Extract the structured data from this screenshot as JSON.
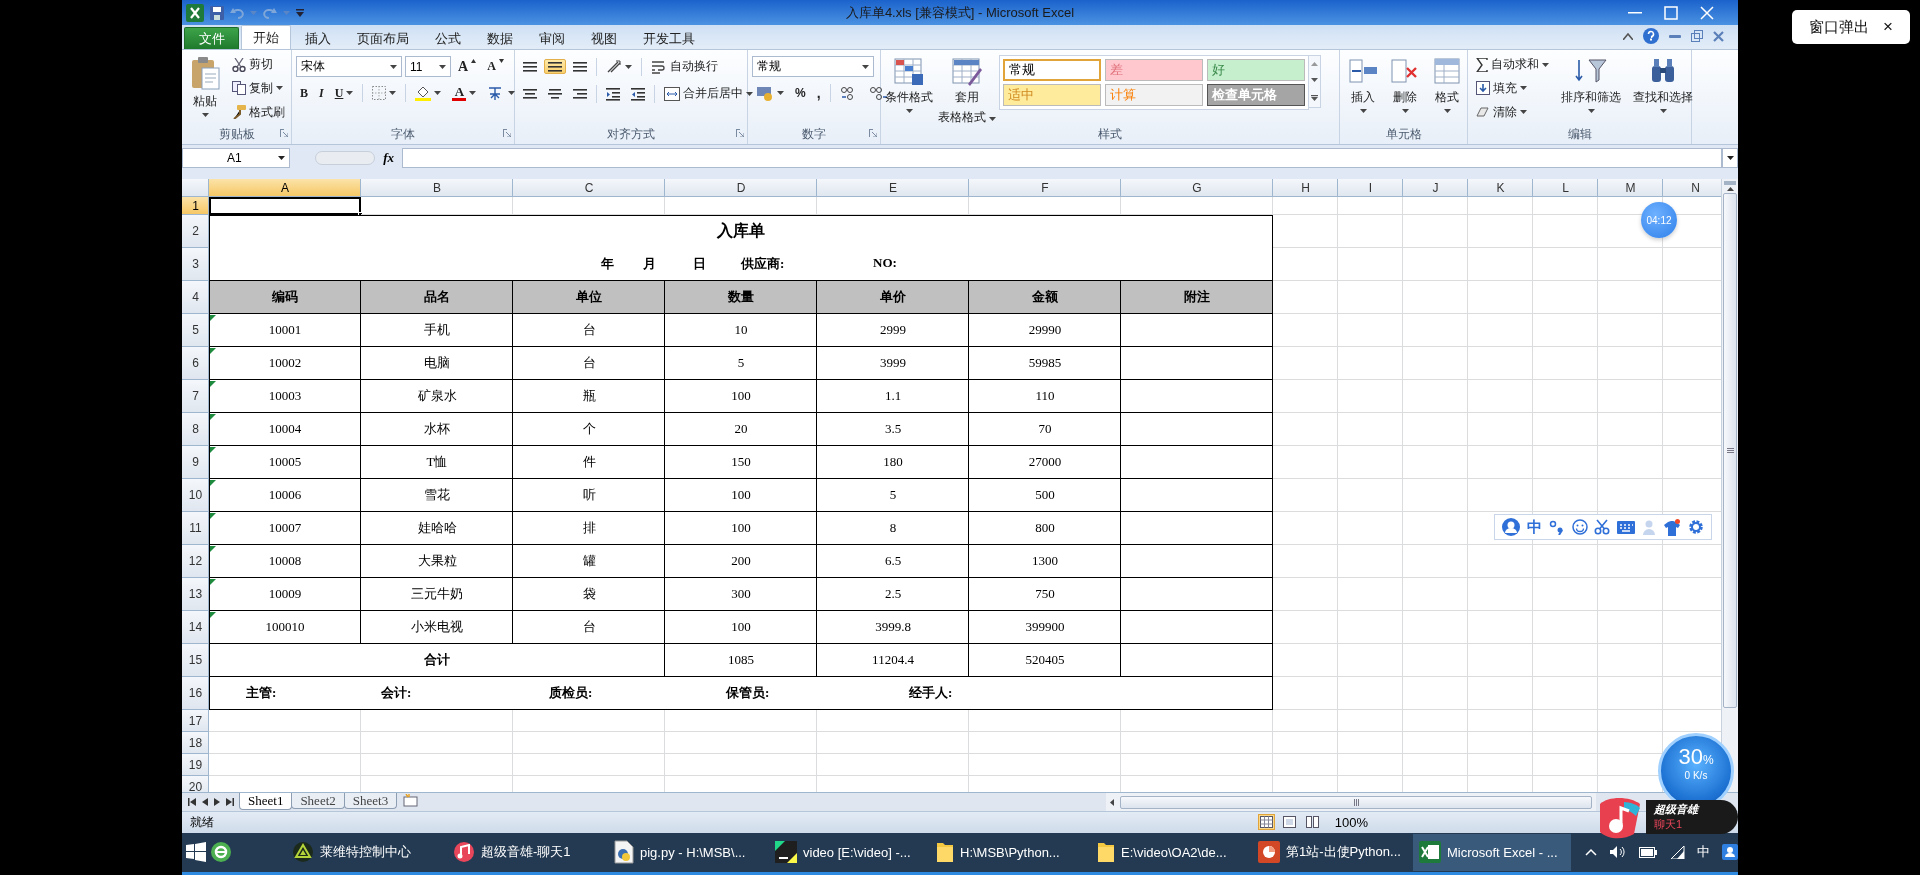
{
  "title_bar": {
    "title": "入库单4.xls [兼容模式] - Microsoft Excel"
  },
  "ribbon_tabs": [
    {
      "label": "文件",
      "kind": "file",
      "selected": false
    },
    {
      "label": "开始",
      "kind": "tab",
      "selected": true
    },
    {
      "label": "插入",
      "kind": "tab",
      "selected": false
    },
    {
      "label": "页面布局",
      "kind": "tab",
      "selected": false
    },
    {
      "label": "公式",
      "kind": "tab",
      "selected": false
    },
    {
      "label": "数据",
      "kind": "tab",
      "selected": false
    },
    {
      "label": "审阅",
      "kind": "tab",
      "selected": false
    },
    {
      "label": "视图",
      "kind": "tab",
      "selected": false
    },
    {
      "label": "开发工具",
      "kind": "tab",
      "selected": false
    }
  ],
  "ribbon": {
    "clipboard": {
      "label": "剪贴板",
      "paste": "粘贴",
      "cut": "剪切",
      "copy": "复制",
      "format_painter": "格式刷"
    },
    "font": {
      "label": "字体",
      "font_name": "宋体",
      "font_size": "11",
      "grow": "A",
      "shrink": "A",
      "bold": "B",
      "italic": "I",
      "underline": "U",
      "font_color": "A"
    },
    "alignment": {
      "label": "对齐方式",
      "vertical": [
        {
          "selected": false
        },
        {
          "selected": true
        },
        {
          "selected": false
        }
      ],
      "wrap_text": "自动换行",
      "merge_center": "合并后居中"
    },
    "number": {
      "label": "数字",
      "format": "常规",
      "percent": "%",
      "comma": ","
    },
    "styles": {
      "label": "样式",
      "conditional": "条件格式",
      "table_format_1": "套用",
      "table_format_2": "表格格式",
      "gallery": [
        {
          "label": "常规",
          "color": "#ffffff",
          "selected": true
        },
        {
          "label": "差",
          "color": "#ffc7ce",
          "selected": false
        },
        {
          "label": "好",
          "color": "#c6efce",
          "selected": false
        },
        {
          "label": "适中",
          "color": "#ffeb9c",
          "selected": false
        },
        {
          "label": "计算",
          "color": "#f2f2f2",
          "selected": false
        },
        {
          "label": "检查单元格",
          "color": "#a5a5a5",
          "selected": false
        }
      ]
    },
    "cells": {
      "label": "单元格",
      "buttons": [
        "插入",
        "删除",
        "格式"
      ]
    },
    "editing": {
      "label": "编辑",
      "small": [
        "自动求和",
        "填充",
        "清除"
      ],
      "big": [
        "排序和筛选",
        "查找和选择"
      ]
    }
  },
  "formula_bar": {
    "name_box": "A1",
    "fx": "fx"
  },
  "sheet": {
    "columns": [
      {
        "label": "A",
        "selected": true
      },
      {
        "label": "B",
        "selected": false
      },
      {
        "label": "C",
        "selected": false
      },
      {
        "label": "D",
        "selected": false
      },
      {
        "label": "E",
        "selected": false
      },
      {
        "label": "F",
        "selected": false
      },
      {
        "label": "G",
        "selected": false
      },
      {
        "label": "H",
        "selected": false
      },
      {
        "label": "I",
        "selected": false
      },
      {
        "label": "J",
        "selected": false
      },
      {
        "label": "K",
        "selected": false
      },
      {
        "label": "L",
        "selected": false
      },
      {
        "label": "M",
        "selected": false
      },
      {
        "label": "N",
        "selected": false
      }
    ],
    "row_numbers": [
      {
        "label": "1",
        "selected": true
      },
      {
        "label": "2",
        "selected": false
      },
      {
        "label": "3",
        "selected": false
      },
      {
        "label": "4",
        "selected": false
      },
      {
        "label": "5",
        "selected": false
      },
      {
        "label": "6",
        "selected": false
      },
      {
        "label": "7",
        "selected": false
      },
      {
        "label": "8",
        "selected": false
      },
      {
        "label": "9",
        "selected": false
      },
      {
        "label": "10",
        "selected": false
      },
      {
        "label": "11",
        "selected": false
      },
      {
        "label": "12",
        "selected": false
      },
      {
        "label": "13",
        "selected": false
      },
      {
        "label": "14",
        "selected": false
      },
      {
        "label": "15",
        "selected": false
      },
      {
        "label": "16",
        "selected": false
      },
      {
        "label": "17",
        "selected": false
      },
      {
        "label": "18",
        "selected": false
      },
      {
        "label": "19",
        "selected": false
      },
      {
        "label": "20",
        "selected": false
      }
    ],
    "form": {
      "title": "入库单",
      "info": [
        "年",
        "月",
        "日",
        "供应商:",
        "NO:"
      ],
      "headers": [
        "编码",
        "品名",
        "单位",
        "数量",
        "单价",
        "金额",
        "附注"
      ],
      "rows": [
        [
          "10001",
          "手机",
          "台",
          "10",
          "2999",
          "29990"
        ],
        [
          "10002",
          "电脑",
          "台",
          "5",
          "3999",
          "59985"
        ],
        [
          "10003",
          "矿泉水",
          "瓶",
          "100",
          "1.1",
          "110"
        ],
        [
          "10004",
          "水杯",
          "个",
          "20",
          "3.5",
          "70"
        ],
        [
          "10005",
          "T恤",
          "件",
          "150",
          "180",
          "27000"
        ],
        [
          "10006",
          "雪花",
          "听",
          "100",
          "5",
          "500"
        ],
        [
          "10007",
          "娃哈哈",
          "排",
          "100",
          "8",
          "800"
        ],
        [
          "10008",
          "大果粒",
          "罐",
          "200",
          "6.5",
          "1300"
        ],
        [
          "10009",
          "三元牛奶",
          "袋",
          "300",
          "2.5",
          "750"
        ],
        [
          "100010",
          "小米电视",
          "台",
          "100",
          "3999.8",
          "399900"
        ]
      ],
      "total": {
        "label": "合计",
        "values": [
          "1085",
          "11204.4",
          "520405"
        ]
      },
      "signatures": [
        "主管:",
        "会计:",
        "质检员:",
        "保管员:",
        "经手人:"
      ]
    }
  },
  "sheet_tabs": [
    {
      "label": "Sheet1",
      "selected": true
    },
    {
      "label": "Sheet2",
      "selected": false
    },
    {
      "label": "Sheet3",
      "selected": false
    }
  ],
  "status_bar": {
    "ready": "就绪",
    "zoom": "100%"
  },
  "taskbar": {
    "items": [
      {
        "label": "莱维特控制中心",
        "selected": false
      },
      {
        "label": "超级音雄-聊天1",
        "selected": false
      },
      {
        "label": "pig.py - H:\\MSB\\...",
        "selected": false
      },
      {
        "label": "video [E:\\video] -...",
        "selected": false
      },
      {
        "label": "H:\\MSB\\Python...",
        "selected": false
      },
      {
        "label": "E:\\video\\OA2\\de...",
        "selected": false
      },
      {
        "label": "第1站-出使Python...",
        "selected": false
      },
      {
        "label": "Microsoft Excel - ...",
        "selected": true
      }
    ],
    "ime": "中"
  },
  "overlays": {
    "popout": {
      "label": "窗口弹出",
      "close": "×"
    },
    "timer": "04:12",
    "ime_toolbar": {
      "mode": "中"
    },
    "speed": {
      "percent": "30",
      "unit": "%",
      "rate": "0 K/s"
    },
    "music": {
      "title": "超级音雄",
      "subtitle": "聊天1"
    }
  }
}
